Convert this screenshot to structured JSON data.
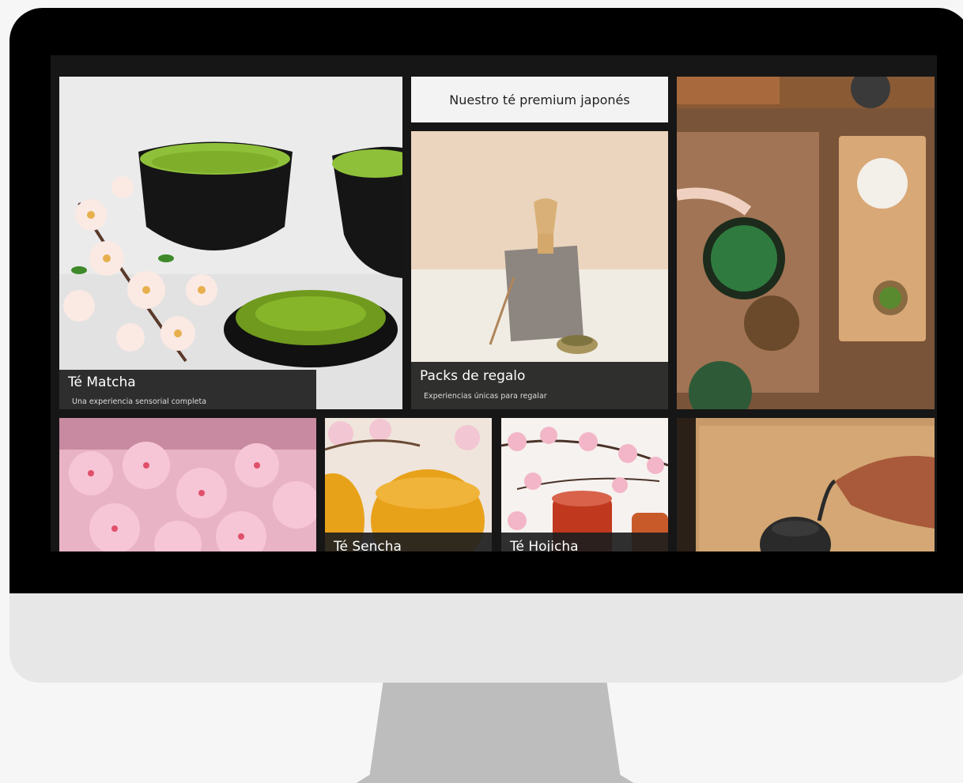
{
  "tiles": {
    "matcha": {
      "title": "Té Matcha",
      "subtitle": "Una experiencia sensorial completa"
    },
    "header": {
      "title": "Nuestro té premium japonés"
    },
    "gifts": {
      "title": "Packs de regalo",
      "subtitle": "Experiencias únicas para regalar"
    },
    "sencha": {
      "title": "Té Sencha"
    },
    "hojicha": {
      "title": "Té Hojicha"
    }
  },
  "colors": {
    "bezel": "#000000",
    "screen": "#161616",
    "caption_bg": "#1e1e1e",
    "matcha_green": "#7fae2a",
    "blossom_pink": "#f3a9c6",
    "wood": "#8a5a35"
  },
  "icons": {
    "monitor": "desktop-monitor-frame"
  }
}
